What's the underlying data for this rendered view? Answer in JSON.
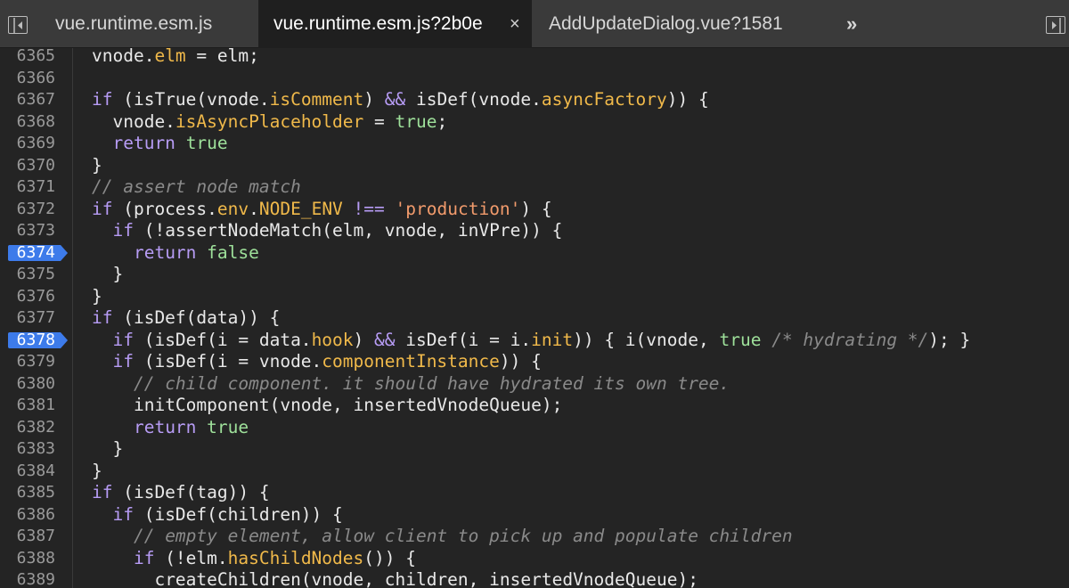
{
  "tabs": [
    {
      "label": "vue.runtime.esm.js",
      "active": false
    },
    {
      "label": "vue.runtime.esm.js?2b0e",
      "active": true,
      "close": "×"
    },
    {
      "label": "AddUpdateDialog.vue?1581",
      "active": false
    }
  ],
  "tab_overflow": "»",
  "icons": {
    "left_panel": "sidebar-toggle-left-icon",
    "right_panel": "sidebar-toggle-right-icon"
  },
  "colors": {
    "breakpoint": "#3d7bea",
    "keyword": "#b79cf5",
    "property": "#f0b94a",
    "literal": "#9ee09a",
    "string": "#f29b6c",
    "comment": "#8a8a8a"
  },
  "breakpoints": [
    "6374",
    "6378"
  ],
  "lines": [
    {
      "num": "6365",
      "indent": "",
      "tokens": [
        [
          "p",
          "vnode."
        ],
        [
          "prop",
          "elm"
        ],
        [
          "p",
          " = elm;"
        ]
      ]
    },
    {
      "num": "6366",
      "indent": "",
      "tokens": []
    },
    {
      "num": "6367",
      "indent": "",
      "tokens": [
        [
          "kw",
          "if"
        ],
        [
          "p",
          " (isTrue(vnode."
        ],
        [
          "prop",
          "isComment"
        ],
        [
          "p",
          ") "
        ],
        [
          "kw",
          "&&"
        ],
        [
          "p",
          " isDef(vnode."
        ],
        [
          "prop",
          "asyncFactory"
        ],
        [
          "p",
          ")) {"
        ]
      ]
    },
    {
      "num": "6368",
      "indent": "  ",
      "tokens": [
        [
          "p",
          "vnode."
        ],
        [
          "prop",
          "isAsyncPlaceholder"
        ],
        [
          "p",
          " = "
        ],
        [
          "lit",
          "true"
        ],
        [
          "p",
          ";"
        ]
      ]
    },
    {
      "num": "6369",
      "indent": "  ",
      "tokens": [
        [
          "kw",
          "return"
        ],
        [
          "p",
          " "
        ],
        [
          "lit",
          "true"
        ]
      ]
    },
    {
      "num": "6370",
      "indent": "",
      "tokens": [
        [
          "p",
          "}"
        ]
      ]
    },
    {
      "num": "6371",
      "indent": "",
      "tokens": [
        [
          "cmt",
          "// assert node match"
        ]
      ]
    },
    {
      "num": "6372",
      "indent": "",
      "tokens": [
        [
          "kw",
          "if"
        ],
        [
          "p",
          " (process."
        ],
        [
          "prop",
          "env"
        ],
        [
          "p",
          "."
        ],
        [
          "prop",
          "NODE_ENV"
        ],
        [
          "p",
          " "
        ],
        [
          "kw",
          "!=="
        ],
        [
          "p",
          " "
        ],
        [
          "str",
          "'production'"
        ],
        [
          "p",
          ") {"
        ]
      ]
    },
    {
      "num": "6373",
      "indent": "  ",
      "tokens": [
        [
          "kw",
          "if"
        ],
        [
          "p",
          " (!assertNodeMatch(elm, vnode, inVPre)) {"
        ]
      ]
    },
    {
      "num": "6374",
      "indent": "    ",
      "tokens": [
        [
          "kw",
          "return"
        ],
        [
          "p",
          " "
        ],
        [
          "lit",
          "false"
        ]
      ]
    },
    {
      "num": "6375",
      "indent": "  ",
      "tokens": [
        [
          "p",
          "}"
        ]
      ]
    },
    {
      "num": "6376",
      "indent": "",
      "tokens": [
        [
          "p",
          "}"
        ]
      ]
    },
    {
      "num": "6377",
      "indent": "",
      "tokens": [
        [
          "kw",
          "if"
        ],
        [
          "p",
          " (isDef(data)) {"
        ]
      ]
    },
    {
      "num": "6378",
      "indent": "  ",
      "tokens": [
        [
          "kw",
          "if"
        ],
        [
          "p",
          " (isDef(i = data."
        ],
        [
          "prop",
          "hook"
        ],
        [
          "p",
          ") "
        ],
        [
          "kw",
          "&&"
        ],
        [
          "p",
          " isDef(i = i."
        ],
        [
          "prop",
          "init"
        ],
        [
          "p",
          ")) { i(vnode, "
        ],
        [
          "lit",
          "true"
        ],
        [
          "p",
          " "
        ],
        [
          "cmt",
          "/* hydrating */"
        ],
        [
          "p",
          "); }"
        ]
      ]
    },
    {
      "num": "6379",
      "indent": "  ",
      "tokens": [
        [
          "kw",
          "if"
        ],
        [
          "p",
          " (isDef(i = vnode."
        ],
        [
          "prop",
          "componentInstance"
        ],
        [
          "p",
          ")) {"
        ]
      ]
    },
    {
      "num": "6380",
      "indent": "    ",
      "tokens": [
        [
          "cmt",
          "// child component. it should have hydrated its own tree."
        ]
      ]
    },
    {
      "num": "6381",
      "indent": "    ",
      "tokens": [
        [
          "p",
          "initComponent(vnode, insertedVnodeQueue);"
        ]
      ]
    },
    {
      "num": "6382",
      "indent": "    ",
      "tokens": [
        [
          "kw",
          "return"
        ],
        [
          "p",
          " "
        ],
        [
          "lit",
          "true"
        ]
      ]
    },
    {
      "num": "6383",
      "indent": "  ",
      "tokens": [
        [
          "p",
          "}"
        ]
      ]
    },
    {
      "num": "6384",
      "indent": "",
      "tokens": [
        [
          "p",
          "}"
        ]
      ]
    },
    {
      "num": "6385",
      "indent": "",
      "tokens": [
        [
          "kw",
          "if"
        ],
        [
          "p",
          " (isDef(tag)) {"
        ]
      ]
    },
    {
      "num": "6386",
      "indent": "  ",
      "tokens": [
        [
          "kw",
          "if"
        ],
        [
          "p",
          " (isDef(children)) {"
        ]
      ]
    },
    {
      "num": "6387",
      "indent": "    ",
      "tokens": [
        [
          "cmt",
          "// empty element, allow client to pick up and populate children"
        ]
      ]
    },
    {
      "num": "6388",
      "indent": "    ",
      "tokens": [
        [
          "kw",
          "if"
        ],
        [
          "p",
          " (!elm."
        ],
        [
          "prop",
          "hasChildNodes"
        ],
        [
          "p",
          "()) {"
        ]
      ]
    },
    {
      "num": "6389",
      "indent": "      ",
      "tokens": [
        [
          "p",
          "createChildren(vnode, children, insertedVnodeQueue);"
        ]
      ]
    }
  ]
}
